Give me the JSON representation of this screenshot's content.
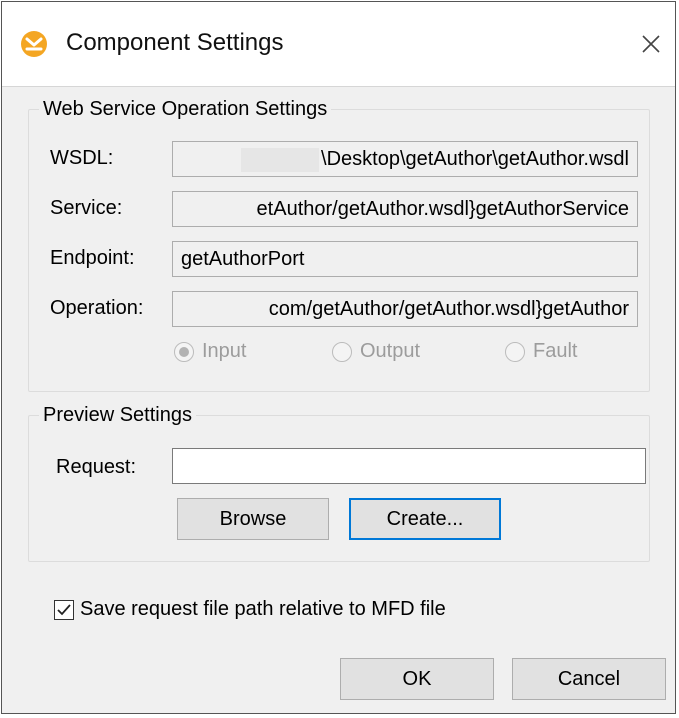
{
  "window": {
    "title": "Component Settings",
    "close_glyph": "✕",
    "icons": {
      "app": "mapforce-app-icon",
      "close": "close-icon"
    }
  },
  "wsdl_group": {
    "legend": "Web Service Operation Settings",
    "wsdl_label": "WSDL:",
    "wsdl_value": "\\Desktop\\getAuthor\\getAuthor.wsdl",
    "service_label": "Service:",
    "service_value": "etAuthor/getAuthor.wsdl}getAuthorService",
    "endpoint_label": "Endpoint:",
    "endpoint_value": "getAuthorPort",
    "operation_label": "Operation:",
    "operation_value": "com/getAuthor/getAuthor.wsdl}getAuthor",
    "radios": [
      {
        "label": "Input",
        "checked": true
      },
      {
        "label": "Output",
        "checked": false
      },
      {
        "label": "Fault",
        "checked": false
      }
    ]
  },
  "preview_group": {
    "legend": "Preview Settings",
    "request_label": "Request:",
    "request_value": "",
    "browse_label": "Browse",
    "create_label": "Create..."
  },
  "save_relative": {
    "label": "Save request file path relative to MFD file",
    "checked": true
  },
  "footer": {
    "ok_label": "OK",
    "cancel_label": "Cancel"
  },
  "colors": {
    "focus_border": "#0078d7",
    "app_icon": "#f4a623"
  }
}
